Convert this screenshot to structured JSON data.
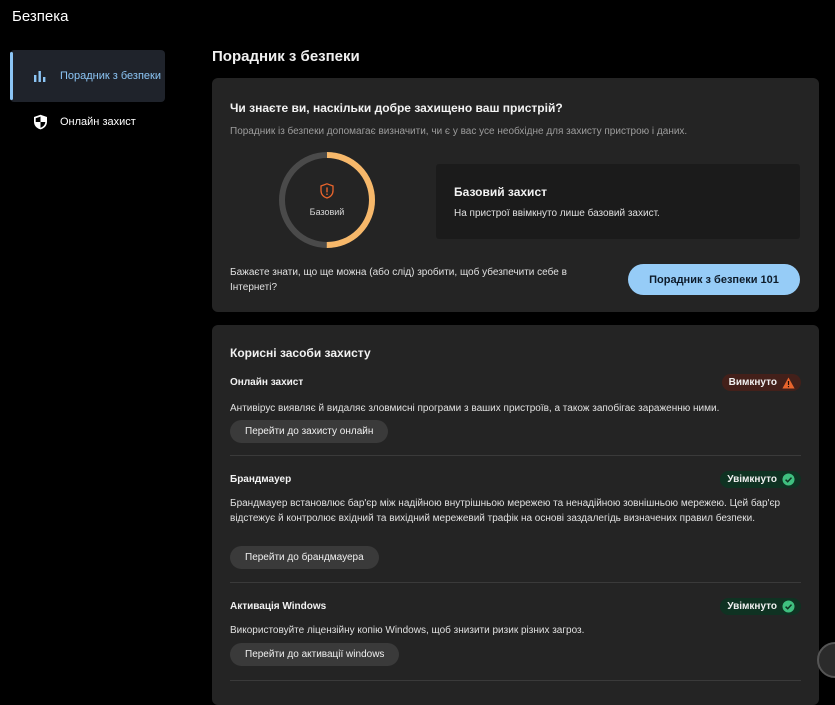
{
  "app": {
    "title": "Безпека"
  },
  "sidebar": {
    "items": [
      {
        "label": "Порадник з безпеки",
        "icon": "bar-chart-icon",
        "active": true
      },
      {
        "label": "Онлайн захист",
        "icon": "shield-icon",
        "active": false
      }
    ]
  },
  "main": {
    "title": "Порадник з безпеки",
    "advisor": {
      "heading": "Чи знаєте ви, наскільки добре захищено ваш пристрій?",
      "subtitle": "Порадник із безпеки допомагає визначити, чи є у вас усе необхідне для захисту пристрою і даних.",
      "ring": {
        "label": "Базовий",
        "progress": 0.5,
        "color": "#f7b86a",
        "track_color": "#4a4a4a"
      },
      "status": {
        "title": "Базовий захист",
        "description": "На пристрої ввімкнуто лише базовий захист."
      },
      "question": "Бажаєте знати, що ще можна (або слід) зробити, щоб убезпечити себе в Інтернеті?",
      "button": "Порадник з безпеки 101"
    },
    "tools": {
      "title": "Корисні засоби захисту",
      "items": [
        {
          "name": "Онлайн захист",
          "status": "Вимкнуто",
          "state": "off",
          "description": "Антивірус виявляє й видаляє зловмисні програми з ваших пристроїв, а також запобігає зараженню ними.",
          "button": "Перейти до захисту онлайн"
        },
        {
          "name": "Брандмауер",
          "status": "Увімкнуто",
          "state": "on",
          "description": "Брандмауер встановлює бар'єр між надійною внутрішньою мережею та ненадійною зовнішньою мережею. Цей бар'єр відстежує й контролює вхідний та вихідний мережевий трафік на основі заздалегідь визначених правил безпеки.",
          "button": "Перейти до брандмауера"
        },
        {
          "name": "Активація Windows",
          "status": "Увімкнуто",
          "state": "on",
          "description": "Використовуйте ліцензійну копію Windows, щоб знизити ризик різних загроз.",
          "button": "Перейти до активації windows"
        }
      ]
    }
  },
  "colors": {
    "accent": "#96ccf7",
    "warning": "#e8642c",
    "success": "#3fbf7f"
  }
}
